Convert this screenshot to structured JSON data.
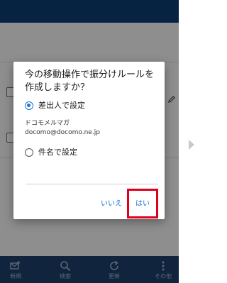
{
  "dialog": {
    "title": "今の移動操作で振分けルールを\n作成しますか？",
    "option_sender": {
      "label": "差出人で設定",
      "selected": true
    },
    "sender_name": "ドコモメルマガ",
    "sender_email": "docomo@docomo.ne.jp",
    "option_subject": {
      "label": "件名で設定",
      "selected": false
    },
    "no_label": "いいえ",
    "yes_label": "はい"
  },
  "bottom_nav": [
    {
      "label": "新規",
      "icon": "compose-icon"
    },
    {
      "label": "検索",
      "icon": "search-icon"
    },
    {
      "label": "更新",
      "icon": "refresh-icon"
    },
    {
      "label": "その他",
      "icon": "more-icon"
    }
  ],
  "colors": {
    "app_bar": "#0b3d70",
    "bottom_bar": "#1c3e6a",
    "accent": "#1a73d9",
    "highlight": "#e0001e"
  }
}
